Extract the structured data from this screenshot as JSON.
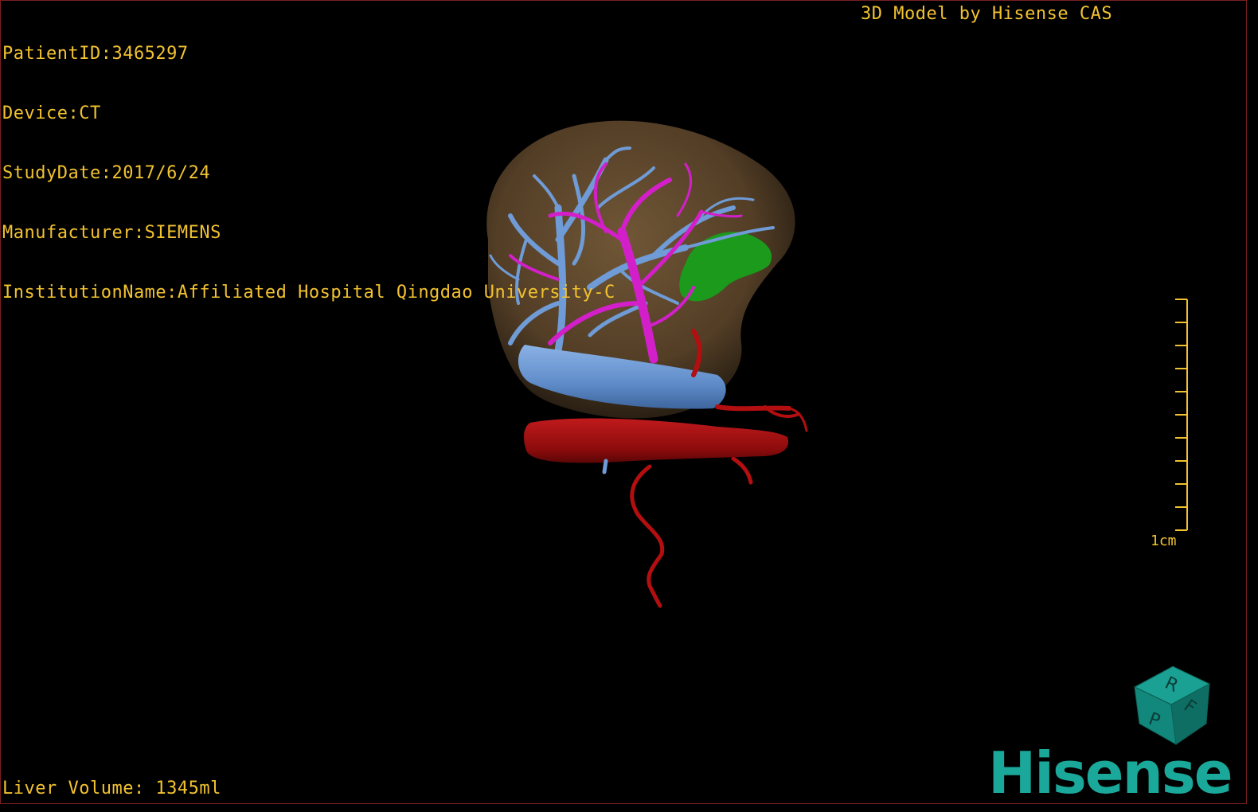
{
  "overlay": {
    "patient_id": "PatientID:3465297",
    "device": "Device:CT",
    "study_date": "StudyDate:2017/6/24",
    "manufacturer": "Manufacturer:SIEMENS",
    "institution": "InstitutionName:Affiliated Hospital Qingdao University-C",
    "caption": "3D Model by Hisense CAS",
    "liver_volume": "Liver Volume: 1345ml"
  },
  "scale": {
    "label": "1cm",
    "ticks": 11
  },
  "orientation_cube": {
    "faces": [
      "R",
      "F",
      "P"
    ],
    "color": "#1a8a80"
  },
  "logo": {
    "text": "Hisense",
    "color": "#1aa89a"
  },
  "colors": {
    "text": "#f2c230",
    "liver": "#6b5233",
    "portal_vein": "#6f9bd6",
    "hepatic_vein": "#d31fc9",
    "artery": "#b30e10",
    "lesion": "#1b9a1b",
    "border": "#7a1f1f"
  }
}
